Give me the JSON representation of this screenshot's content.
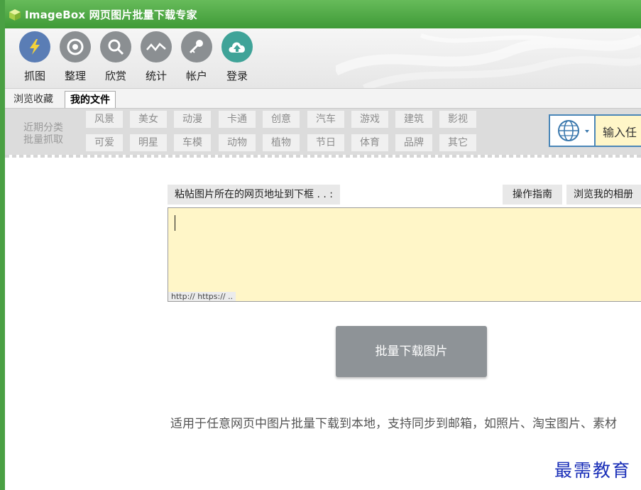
{
  "window": {
    "title": "ImageBox 网页图片批量下载专家"
  },
  "toolbar": {
    "items": [
      {
        "label": "抓图",
        "icon": "lightning-icon"
      },
      {
        "label": "整理",
        "icon": "target-icon"
      },
      {
        "label": "欣赏",
        "icon": "magnifier-icon"
      },
      {
        "label": "统计",
        "icon": "chart-line-icon"
      },
      {
        "label": "帐户",
        "icon": "key-icon"
      },
      {
        "label": "登录",
        "icon": "cloud-upload-icon"
      }
    ]
  },
  "tabs": {
    "browse": "浏览收藏",
    "my_files": "我的文件"
  },
  "categories": {
    "row_labels": [
      "近期分类",
      "批量抓取"
    ],
    "row1": [
      "风景",
      "美女",
      "动漫",
      "卡通",
      "创意",
      "汽车",
      "游戏",
      "建筑",
      "影视"
    ],
    "row2": [
      "可爱",
      "明星",
      "车模",
      "动物",
      "植物",
      "节日",
      "体育",
      "品牌",
      "其它"
    ]
  },
  "search": {
    "placeholder": "输入任"
  },
  "main": {
    "url_label": "粘帖图片所在的网页地址到下框 . . :",
    "guide_button": "操作指南",
    "album_button": "浏览我的相册",
    "url_hint": "http:// https:// ..",
    "download_button": "批量下载图片",
    "description": "适用于任意网页中图片批量下载到本地，支持同步到邮箱，如照片、淘宝图片、素材"
  },
  "watermark": "最需教育",
  "colors": {
    "title_green": "#4aa043",
    "toolbar_active": "#5a7db5",
    "login_teal": "#3fa398",
    "input_yellow": "#fff6c8",
    "search_border": "#4a86b8",
    "watermark_blue": "#1a2fb8"
  }
}
